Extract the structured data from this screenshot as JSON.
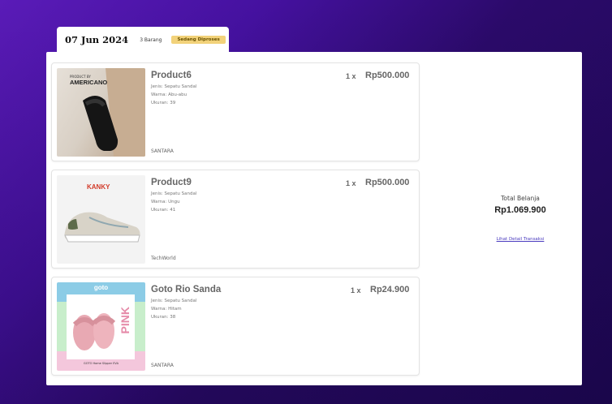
{
  "header": {
    "date": "07 Jun 2024",
    "count": "3 Barang",
    "status": "Sedang Diproses"
  },
  "colors": {
    "status_badge_bg": "#f2d27a",
    "background": "#3a0d8c",
    "link": "#4a3bbf"
  },
  "items": [
    {
      "name": "Product6",
      "qty": "1 x",
      "price": "Rp500.000",
      "attr1": "Jenis: Sepatu Sandal",
      "attr2": "Warna: Abu-abu",
      "attr3": "Ukuran: 39",
      "store": "SANTARA",
      "image_text": "AMERICANO",
      "image_subtext": "PRODUCT BY"
    },
    {
      "name": "Product9",
      "qty": "1 x",
      "price": "Rp500.000",
      "attr1": "Jenis: Sepatu Sandal",
      "attr2": "Warna: Ungu",
      "attr3": "Ukuran: 41",
      "store": "TechWorld",
      "image_text": "KANKY"
    },
    {
      "name": "Goto Rio Sanda",
      "qty": "1 x",
      "price": "Rp24.900",
      "attr1": "Jenis: Sepatu Sandal",
      "attr2": "Warna: Hitam",
      "attr3": "Ukuran: 38",
      "store": "SANTARA",
      "image_text": "goto",
      "image_subtext": "PINK",
      "image_caption": "GOTO Home Slipper EVA"
    }
  ],
  "summary": {
    "total_label": "Total Belanja",
    "total_value": "Rp1.069.900",
    "detail_link": "Lihat Detail Transaksi"
  }
}
